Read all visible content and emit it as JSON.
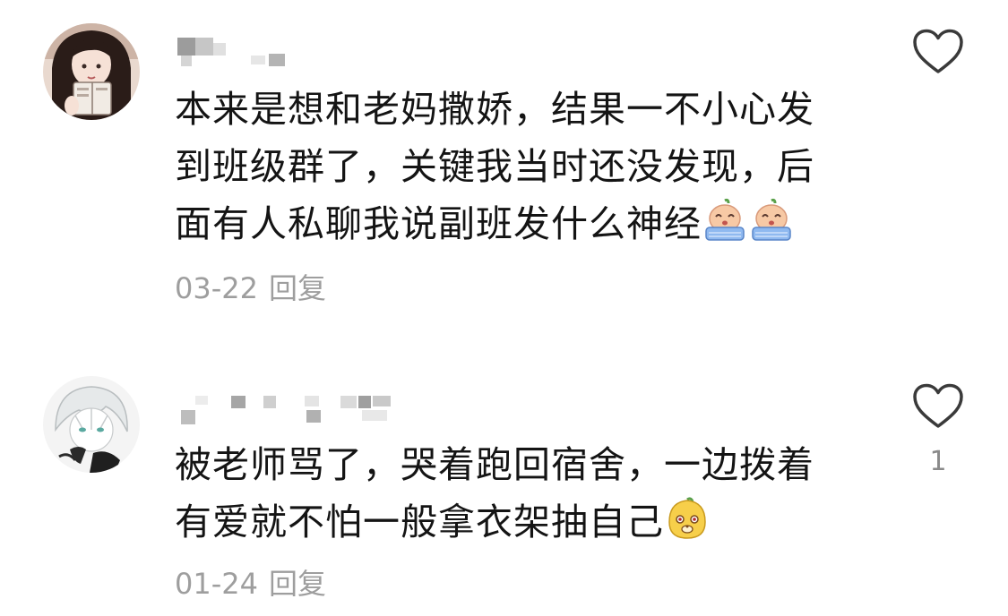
{
  "comments": [
    {
      "lines": [
        "本来是想和老妈撒娇，结果一不小心发",
        "到班级群了，关键我当时还没发现，后",
        "面有人私聊我说副班发什么神经"
      ],
      "emojis": [
        "crying-peach-emoji",
        "crying-peach-emoji"
      ],
      "date": "03-22",
      "reply_label": "回复",
      "like_count": ""
    },
    {
      "lines": [
        "被老师骂了，哭着跑回宿舍，一边拨着",
        "有爱就不怕一般拿衣架抽自己"
      ],
      "emojis": [
        "smirking-peach-emoji"
      ],
      "date": "01-24",
      "reply_label": "回复",
      "like_count": "1"
    }
  ],
  "icons": {
    "like": "heart-outline-icon",
    "avatar_1": "avatar-girl-holding-book",
    "avatar_2": "avatar-anime-white-hair"
  },
  "colors": {
    "text": "#141414",
    "meta": "#9e9e9e",
    "icon": "#3a3a3a",
    "emoji_peach": "#f7c9a5",
    "emoji_tears": "#8fb9f0",
    "emoji_yellow": "#f7cf4a"
  }
}
